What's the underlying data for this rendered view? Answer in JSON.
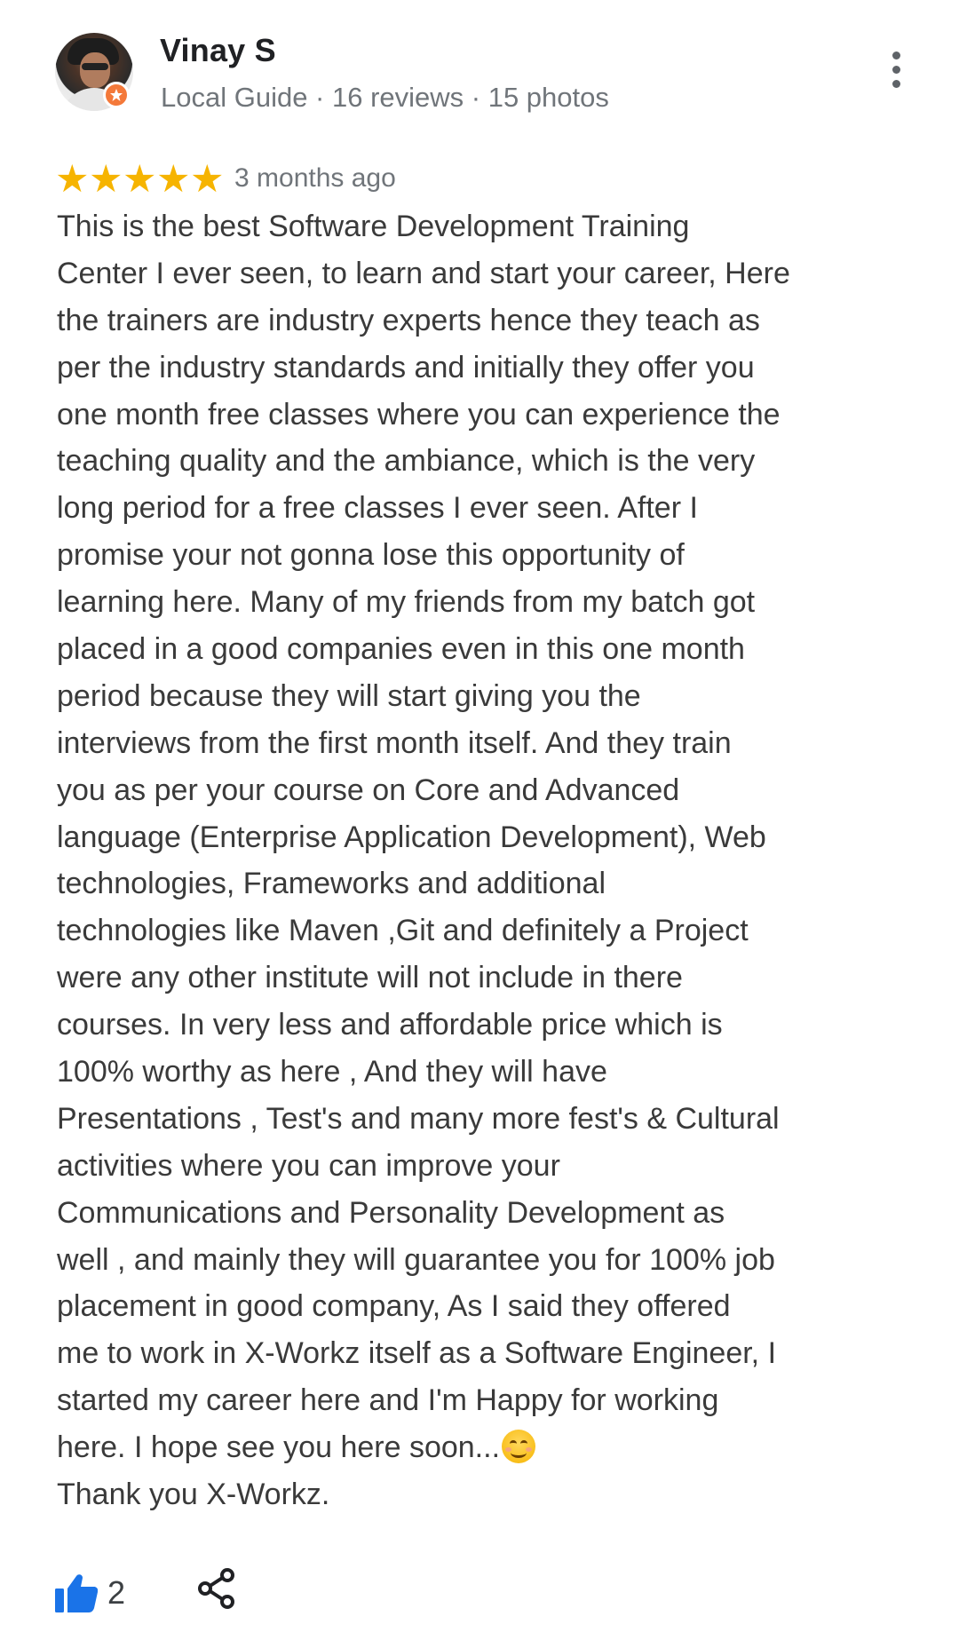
{
  "reviewer": {
    "name": "Vinay S",
    "meta": "Local Guide · 16 reviews · 15 photos"
  },
  "rating": {
    "stars": 5,
    "max_stars": 5,
    "time_ago": "3 months ago"
  },
  "review": {
    "lines": [
      "This is the best Software Development Training",
      "Center I ever seen, to learn and start your career, Here",
      "the trainers are industry experts hence they teach as",
      "per the industry standards and initially they offer you",
      "one month free classes where you can experience the",
      "teaching quality and the ambiance, which is the very",
      "long period for a free classes I ever seen. After I",
      "promise your not gonna lose this opportunity of",
      "learning here. Many of my friends from my batch got",
      "placed in a good companies even in this one month",
      "period because they will start giving you the",
      "interviews from the first month itself. And they train",
      "you as per your course on Core and Advanced",
      "language (Enterprise Application Development), Web",
      "technologies, Frameworks and additional",
      "technologies like Maven ,Git and definitely a Project",
      "were any other institute will not include in there",
      "courses. In very less and affordable price which is",
      "100% worthy as here , And they will have",
      "Presentations , Test's and many more fest's & Cultural",
      "activities where you can improve your",
      "Communications and Personality Development as",
      "well , and mainly they will guarantee you for 100% job",
      "placement in good company, As I said they offered",
      "me to work in X-Workz itself as a Software Engineer, I",
      "started my career here and I'm Happy for working",
      "here. I hope see you here soon...",
      "Thank you X-Workz."
    ],
    "emoji_icon": "smiling-face-emoji"
  },
  "actions": {
    "like_count": "2",
    "like_icon": "thumbs-up-icon",
    "share_icon": "share-icon",
    "menu_icon": "more-vert-icon"
  },
  "colors": {
    "star": "#f6b400",
    "like_blue": "#1a73e8",
    "local_guide_badge": "#f4793a",
    "meta_gray": "#70757a"
  }
}
